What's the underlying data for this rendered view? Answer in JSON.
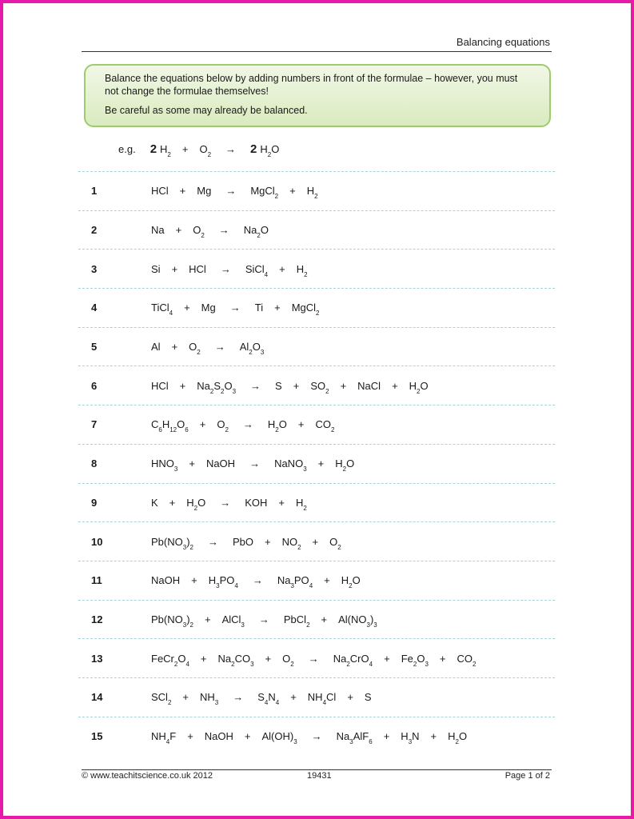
{
  "header": {
    "title": "Balancing equations"
  },
  "instructions": {
    "line1": "Balance the equations below by adding numbers in front of the formulae – however, you must not change the formulae themselves!",
    "line2": "Be careful as some may already be balanced."
  },
  "example": {
    "label": "e.g.",
    "reactants": [
      {
        "coef": "2",
        "formula": [
          [
            "H",
            ""
          ],
          [
            "",
            "2"
          ]
        ]
      },
      {
        "coef": "",
        "formula": [
          [
            "O",
            ""
          ],
          [
            "",
            "2"
          ]
        ]
      }
    ],
    "products": [
      {
        "coef": "2",
        "formula": [
          [
            "H",
            ""
          ],
          [
            "",
            "2"
          ],
          [
            "O",
            ""
          ]
        ]
      }
    ]
  },
  "arrow_symbol": "→",
  "plus_symbol": "+",
  "equations": [
    {
      "num": "1",
      "reactants": [
        [
          [
            "HCl",
            ""
          ]
        ],
        [
          [
            "Mg",
            ""
          ]
        ]
      ],
      "products": [
        [
          [
            "MgCl",
            ""
          ],
          [
            "",
            "2"
          ]
        ],
        [
          [
            "H",
            ""
          ],
          [
            "",
            "2"
          ]
        ]
      ]
    },
    {
      "num": "2",
      "reactants": [
        [
          [
            "Na",
            ""
          ]
        ],
        [
          [
            "O",
            ""
          ],
          [
            "",
            "2"
          ]
        ]
      ],
      "products": [
        [
          [
            "Na",
            ""
          ],
          [
            "",
            "2"
          ],
          [
            "O",
            ""
          ]
        ]
      ]
    },
    {
      "num": "3",
      "reactants": [
        [
          [
            "Si",
            ""
          ]
        ],
        [
          [
            "HCl",
            ""
          ]
        ]
      ],
      "products": [
        [
          [
            "SiCl",
            ""
          ],
          [
            "",
            "4"
          ]
        ],
        [
          [
            "H",
            ""
          ],
          [
            "",
            "2"
          ]
        ]
      ]
    },
    {
      "num": "4",
      "reactants": [
        [
          [
            "TiCl",
            ""
          ],
          [
            "",
            "4"
          ]
        ],
        [
          [
            "Mg",
            ""
          ]
        ]
      ],
      "products": [
        [
          [
            "Ti",
            ""
          ]
        ],
        [
          [
            "MgCl",
            ""
          ],
          [
            "",
            "2"
          ]
        ]
      ]
    },
    {
      "num": "5",
      "reactants": [
        [
          [
            "Al",
            ""
          ]
        ],
        [
          [
            "O",
            ""
          ],
          [
            "",
            "2"
          ]
        ]
      ],
      "products": [
        [
          [
            "Al",
            ""
          ],
          [
            "",
            "2"
          ],
          [
            "O",
            ""
          ],
          [
            "",
            "3"
          ]
        ]
      ]
    },
    {
      "num": "6",
      "reactants": [
        [
          [
            "HCl",
            ""
          ]
        ],
        [
          [
            "Na",
            ""
          ],
          [
            "",
            "2"
          ],
          [
            "S",
            ""
          ],
          [
            "",
            "2"
          ],
          [
            "O",
            ""
          ],
          [
            "",
            "3"
          ]
        ]
      ],
      "products": [
        [
          [
            "S",
            ""
          ]
        ],
        [
          [
            "SO",
            ""
          ],
          [
            "",
            "2"
          ]
        ],
        [
          [
            "NaCl",
            ""
          ]
        ],
        [
          [
            "H",
            ""
          ],
          [
            "",
            "2"
          ],
          [
            "O",
            ""
          ]
        ]
      ]
    },
    {
      "num": "7",
      "reactants": [
        [
          [
            "C",
            ""
          ],
          [
            "",
            "6"
          ],
          [
            "H",
            ""
          ],
          [
            "",
            "12"
          ],
          [
            "O",
            ""
          ],
          [
            "",
            "6"
          ]
        ],
        [
          [
            "O",
            ""
          ],
          [
            "",
            "2"
          ]
        ]
      ],
      "products": [
        [
          [
            "H",
            ""
          ],
          [
            "",
            "2"
          ],
          [
            "O",
            ""
          ]
        ],
        [
          [
            "CO",
            ""
          ],
          [
            "",
            "2"
          ]
        ]
      ]
    },
    {
      "num": "8",
      "reactants": [
        [
          [
            "HNO",
            ""
          ],
          [
            "",
            "3"
          ]
        ],
        [
          [
            "NaOH",
            ""
          ]
        ]
      ],
      "products": [
        [
          [
            "NaNO",
            ""
          ],
          [
            "",
            "3"
          ]
        ],
        [
          [
            "H",
            ""
          ],
          [
            "",
            "2"
          ],
          [
            "O",
            ""
          ]
        ]
      ]
    },
    {
      "num": "9",
      "reactants": [
        [
          [
            "K",
            ""
          ]
        ],
        [
          [
            "H",
            ""
          ],
          [
            "",
            "2"
          ],
          [
            "O",
            ""
          ]
        ]
      ],
      "products": [
        [
          [
            "KOH",
            ""
          ]
        ],
        [
          [
            "H",
            ""
          ],
          [
            "",
            "2"
          ]
        ]
      ]
    },
    {
      "num": "10",
      "reactants": [
        [
          [
            "Pb(NO",
            ""
          ],
          [
            "",
            "3"
          ],
          [
            ")",
            ""
          ],
          [
            "",
            "2"
          ]
        ]
      ],
      "products": [
        [
          [
            "PbO",
            ""
          ]
        ],
        [
          [
            "NO",
            ""
          ],
          [
            "",
            "2"
          ]
        ],
        [
          [
            "O",
            ""
          ],
          [
            "",
            "2"
          ]
        ]
      ]
    },
    {
      "num": "11",
      "reactants": [
        [
          [
            "NaOH",
            ""
          ]
        ],
        [
          [
            "H",
            ""
          ],
          [
            "",
            "3"
          ],
          [
            "PO",
            ""
          ],
          [
            "",
            "4"
          ]
        ]
      ],
      "products": [
        [
          [
            "Na",
            ""
          ],
          [
            "",
            "3"
          ],
          [
            "PO",
            ""
          ],
          [
            "",
            "4"
          ]
        ],
        [
          [
            "H",
            ""
          ],
          [
            "",
            "2"
          ],
          [
            "O",
            ""
          ]
        ]
      ]
    },
    {
      "num": "12",
      "reactants": [
        [
          [
            "Pb(NO",
            ""
          ],
          [
            "",
            "3"
          ],
          [
            ")",
            ""
          ],
          [
            "",
            "2"
          ]
        ],
        [
          [
            "AlCl",
            ""
          ],
          [
            "",
            "3"
          ]
        ]
      ],
      "products": [
        [
          [
            "PbCl",
            ""
          ],
          [
            "",
            "2"
          ]
        ],
        [
          [
            "Al(NO",
            ""
          ],
          [
            "",
            "3"
          ],
          [
            ")",
            ""
          ],
          [
            "",
            "3"
          ]
        ]
      ]
    },
    {
      "num": "13",
      "reactants": [
        [
          [
            "FeCr",
            ""
          ],
          [
            "",
            "2"
          ],
          [
            "O",
            ""
          ],
          [
            "",
            "4"
          ]
        ],
        [
          [
            "Na",
            ""
          ],
          [
            "",
            "2"
          ],
          [
            "CO",
            ""
          ],
          [
            "",
            "3"
          ]
        ],
        [
          [
            "O",
            ""
          ],
          [
            "",
            "2"
          ]
        ]
      ],
      "products": [
        [
          [
            "Na",
            ""
          ],
          [
            "",
            "2"
          ],
          [
            "CrO",
            ""
          ],
          [
            "",
            "4"
          ]
        ],
        [
          [
            "Fe",
            ""
          ],
          [
            "",
            "2"
          ],
          [
            "O",
            ""
          ],
          [
            "",
            "3"
          ]
        ],
        [
          [
            "CO",
            ""
          ],
          [
            "",
            "2"
          ]
        ]
      ]
    },
    {
      "num": "14",
      "reactants": [
        [
          [
            "SCl",
            ""
          ],
          [
            "",
            "2"
          ]
        ],
        [
          [
            "NH",
            ""
          ],
          [
            "",
            "3"
          ]
        ]
      ],
      "products": [
        [
          [
            "S",
            ""
          ],
          [
            "",
            "4"
          ],
          [
            "N",
            ""
          ],
          [
            "",
            "4"
          ]
        ],
        [
          [
            "NH",
            ""
          ],
          [
            "",
            "4"
          ],
          [
            "Cl",
            ""
          ]
        ],
        [
          [
            "S",
            ""
          ]
        ]
      ]
    },
    {
      "num": "15",
      "reactants": [
        [
          [
            "NH",
            ""
          ],
          [
            "",
            "4"
          ],
          [
            "F",
            ""
          ]
        ],
        [
          [
            "NaOH",
            ""
          ]
        ],
        [
          [
            "Al(OH)",
            ""
          ],
          [
            "",
            "3"
          ]
        ]
      ],
      "products": [
        [
          [
            "Na",
            ""
          ],
          [
            "",
            "3"
          ],
          [
            "AlF",
            ""
          ],
          [
            "",
            "6"
          ]
        ],
        [
          [
            "H",
            ""
          ],
          [
            "",
            "3"
          ],
          [
            "N",
            ""
          ]
        ],
        [
          [
            "H",
            ""
          ],
          [
            "",
            "2"
          ],
          [
            "O",
            ""
          ]
        ]
      ]
    }
  ],
  "footer": {
    "copyright": "© www.teachitscience.co.uk 2012",
    "code": "19431",
    "page": "Page 1 of 2"
  },
  "colors": {
    "frame": "#e619a8",
    "box_border": "#9ccc6b",
    "box_fill": "#e3f0cf",
    "row_rule": "#a8d4d6"
  }
}
